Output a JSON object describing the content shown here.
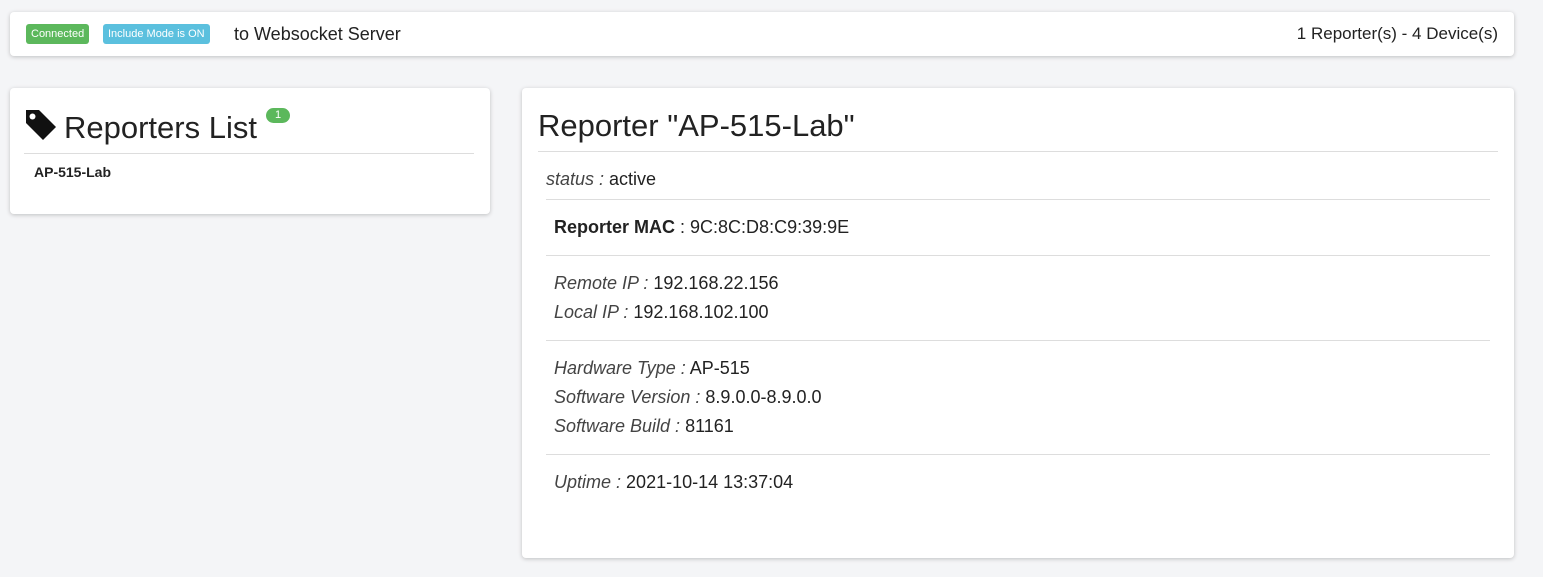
{
  "topbar": {
    "connected_badge": "Connected",
    "include_badge": "Include Mode is ON",
    "server_text": "to Websocket Server",
    "summary": "1 Reporter(s) - 4 Device(s)",
    "connected_color": "#5cb85c",
    "include_color": "#5bc0de"
  },
  "reporters_list": {
    "icon": "tag-icon",
    "title": "Reporters List",
    "count": "1",
    "items": [
      {
        "label": "AP-515-Lab"
      }
    ]
  },
  "reporter_detail": {
    "title": "Reporter \"AP-515-Lab\"",
    "status_label": "status :",
    "status_value": "active",
    "mac_label": "Reporter MAC",
    "mac_value": ": 9C:8C:D8:C9:39:9E",
    "remote_ip_label": "Remote IP :",
    "remote_ip_value": "192.168.22.156",
    "local_ip_label": "Local IP :",
    "local_ip_value": "192.168.102.100",
    "hw_type_label": "Hardware Type :",
    "hw_type_value": "AP-515",
    "sw_version_label": "Software Version :",
    "sw_version_value": "8.9.0.0-8.9.0.0",
    "sw_build_label": "Software Build :",
    "sw_build_value": "81161",
    "uptime_label": "Uptime :",
    "uptime_value": "2021-10-14 13:37:04"
  }
}
